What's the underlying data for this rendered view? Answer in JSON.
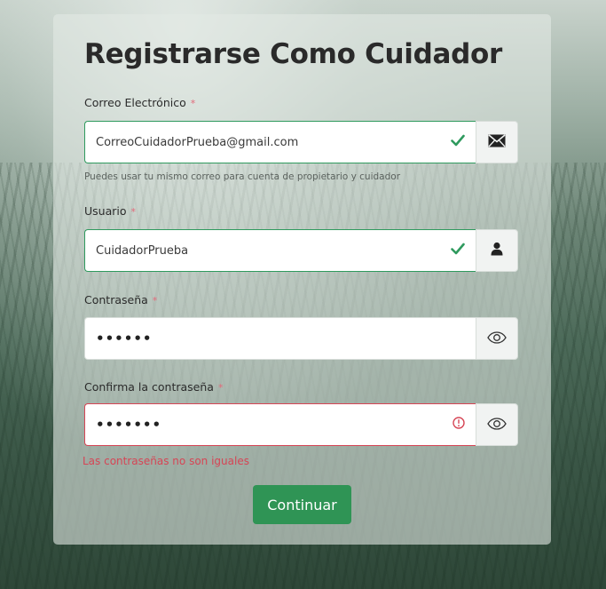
{
  "form": {
    "title": "Registrarse Como Cuidador",
    "required_mark": "*",
    "email": {
      "label": "Correo Electrónico",
      "value": "CorreoCuidadorPrueba@gmail.com",
      "help": "Puedes usar tu mismo correo para cuenta de propietario y cuidador",
      "addon_icon": "envelope-icon",
      "state": "valid"
    },
    "username": {
      "label": "Usuario",
      "value": "CuidadorPrueba",
      "addon_icon": "user-icon",
      "state": "valid"
    },
    "password": {
      "label": "Contraseña",
      "value": "••••••",
      "addon_icon": "eye-icon"
    },
    "confirm": {
      "label": "Confirma la contraseña",
      "value": "•••••••",
      "addon_icon": "eye-icon",
      "state": "invalid",
      "error": "Las contraseñas no son iguales"
    },
    "submit_label": "Continuar"
  },
  "colors": {
    "valid": "#2f9a5e",
    "invalid": "#d64555",
    "button": "#2f9455"
  }
}
